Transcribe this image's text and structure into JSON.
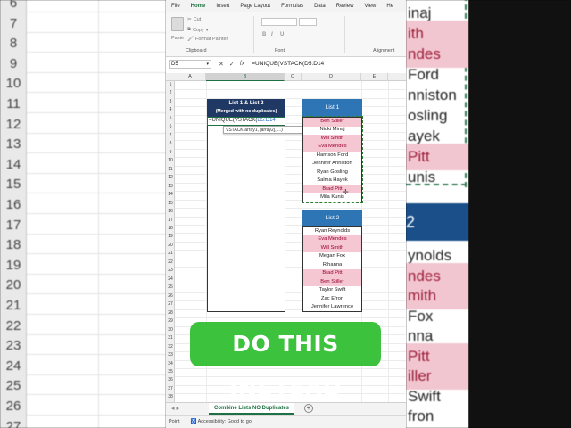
{
  "background_left": {
    "row_numbers": [
      "6",
      "7",
      "8",
      "9",
      "10",
      "11",
      "12",
      "13",
      "14",
      "15",
      "16",
      "17",
      "18",
      "19",
      "20",
      "21",
      "22",
      "23",
      "24",
      "25",
      "26",
      "27"
    ]
  },
  "background_right": {
    "cells": [
      {
        "text": "inaj",
        "pink": false
      },
      {
        "text": "ith",
        "pink": true
      },
      {
        "text": "ndes",
        "pink": true
      },
      {
        "text": "Ford",
        "pink": false
      },
      {
        "text": "nniston",
        "pink": false
      },
      {
        "text": "osling",
        "pink": false
      },
      {
        "text": "ayek",
        "pink": false
      },
      {
        "text": "Pitt",
        "pink": true
      },
      {
        "text": "unis",
        "pink": false
      }
    ],
    "header": "2",
    "cells_lower": [
      {
        "text": "ynolds",
        "pink": false
      },
      {
        "text": "ndes",
        "pink": true
      },
      {
        "text": "mith",
        "pink": true
      },
      {
        "text": "Fox",
        "pink": false
      },
      {
        "text": "nna",
        "pink": false
      },
      {
        "text": "Pitt",
        "pink": true
      },
      {
        "text": "iller",
        "pink": true
      },
      {
        "text": "Swift",
        "pink": false
      },
      {
        "text": "fron",
        "pink": false
      }
    ]
  },
  "menu": {
    "items": [
      "File",
      "Home",
      "Insert",
      "Page Layout",
      "Formulas",
      "Data",
      "Review",
      "View",
      "He"
    ],
    "active": "Home"
  },
  "ribbon": {
    "cut": "Cut",
    "copy": "Copy",
    "format_painter": "Format Painter",
    "paste": "Paste",
    "clipboard_label": "Clipboard",
    "font_label": "Font",
    "alignment_label": "Alignment",
    "bold": "B",
    "italic": "I",
    "underline": "U"
  },
  "formula_bar": {
    "name_box": "D5",
    "formula": "=UNIQUE(VSTACK(D5:D14"
  },
  "columns": [
    "A",
    "B",
    "C",
    "D",
    "E"
  ],
  "rows": [
    "1",
    "2",
    "3",
    "4",
    "5",
    "6",
    "7",
    "8",
    "9",
    "10",
    "11",
    "12",
    "13",
    "14",
    "15",
    "16",
    "17",
    "18",
    "19",
    "20",
    "21",
    "22",
    "23",
    "24",
    "25",
    "26",
    "27",
    "28",
    "29",
    "30",
    "31",
    "32",
    "33",
    "34",
    "35",
    "36",
    "37",
    "38"
  ],
  "merged_table": {
    "title_line1": "List 1 & List 2",
    "title_line2": "(Merged with no duplicates)",
    "formula_prefix": "=UNIQUE(VSTACK(",
    "formula_ref": "D5:D14",
    "tooltip": "VSTACK(array1, [array2], ...)"
  },
  "list1": {
    "title": "List 1",
    "items": [
      {
        "name": "Ben Stiller",
        "pink": true
      },
      {
        "name": "Nicki Minaj",
        "pink": false
      },
      {
        "name": "Will Smith",
        "pink": true
      },
      {
        "name": "Eva Mendes",
        "pink": true
      },
      {
        "name": "Harrison Ford",
        "pink": false
      },
      {
        "name": "Jennifer Anniston",
        "pink": false
      },
      {
        "name": "Ryan Gosling",
        "pink": false
      },
      {
        "name": "Salma Hayek",
        "pink": false
      },
      {
        "name": "Brad Pitt",
        "pink": true
      },
      {
        "name": "Mila Kunis",
        "pink": false
      }
    ]
  },
  "list2": {
    "title": "List 2",
    "items": [
      {
        "name": "Ryan Reynolds",
        "pink": false
      },
      {
        "name": "Eva Mendes",
        "pink": true
      },
      {
        "name": "Will Smith",
        "pink": true
      },
      {
        "name": "Megan Fox",
        "pink": false
      },
      {
        "name": "Rihanna",
        "pink": false
      },
      {
        "name": "Brad Pitt",
        "pink": true
      },
      {
        "name": "Ben Stiller",
        "pink": true
      },
      {
        "name": "Taylor Swift",
        "pink": false
      },
      {
        "name": "Zac Efron",
        "pink": false
      },
      {
        "name": "Jennifer Lawrence",
        "pink": false
      }
    ]
  },
  "sheet_tab": "Combine Lists NO Duplicates",
  "status": {
    "mode": "Point",
    "accessibility": "Accessibility: Good to go"
  },
  "cta": "DO THIS INSTEAD",
  "colors": {
    "excel_green": "#1e7145",
    "header_navy": "#1f3864",
    "header_blue": "#2e75b6",
    "pink_fill": "#f4c7d2",
    "pink_text": "#9c0033",
    "cta_green": "#3cc23c"
  }
}
